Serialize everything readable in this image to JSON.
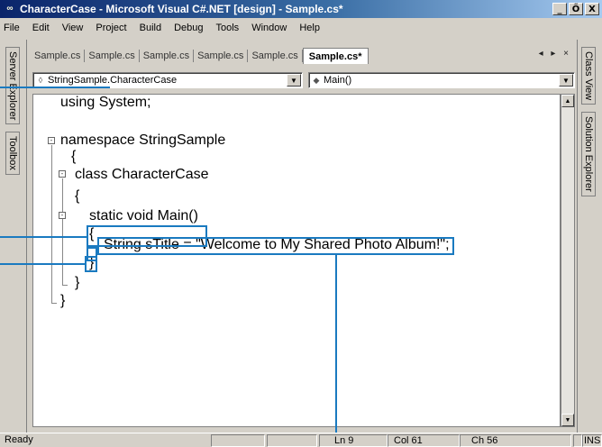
{
  "window": {
    "title": "CharacterCase - Microsoft Visual C#.NET [design] - Sample.cs*",
    "minimize": "_",
    "maximize": "Ő",
    "close": "X"
  },
  "menu": [
    "File",
    "Edit",
    "View",
    "Project",
    "Build",
    "Debug",
    "Tools",
    "Window",
    "Help"
  ],
  "left_tools": [
    "Server Explorer",
    "Toolbox"
  ],
  "right_tools": [
    "Class View",
    "Solution Explorer"
  ],
  "doc_tabs": [
    "Sample.cs",
    "Sample.cs",
    "Sample.cs",
    "Sample.cs",
    "Sample.cs",
    "Sample.cs*"
  ],
  "tab_nav": "◂ ▸ ×",
  "class_dropdown": {
    "value": "StringSample.CharacterCase",
    "icon": "class-icon"
  },
  "member_dropdown": {
    "value": "Main()",
    "icon": "method-icon"
  },
  "code": {
    "l1": "using System;",
    "l2": "namespace StringSample",
    "l3": "{",
    "l4": "class CharacterCase",
    "l5": "{",
    "l6": "static void Main()",
    "l7": "{",
    "l8": "String sTitle = \"Welcome to My Shared Photo Album!\";",
    "l9": "}",
    "l10": "}",
    "l11": "}"
  },
  "status": {
    "ready": "Ready",
    "ln": "Ln 9",
    "col": "Col 61",
    "ch": "Ch 56",
    "ins": "INS"
  },
  "colors": {
    "callout": "#1a7ac0",
    "titlebar": "#0a246a"
  }
}
